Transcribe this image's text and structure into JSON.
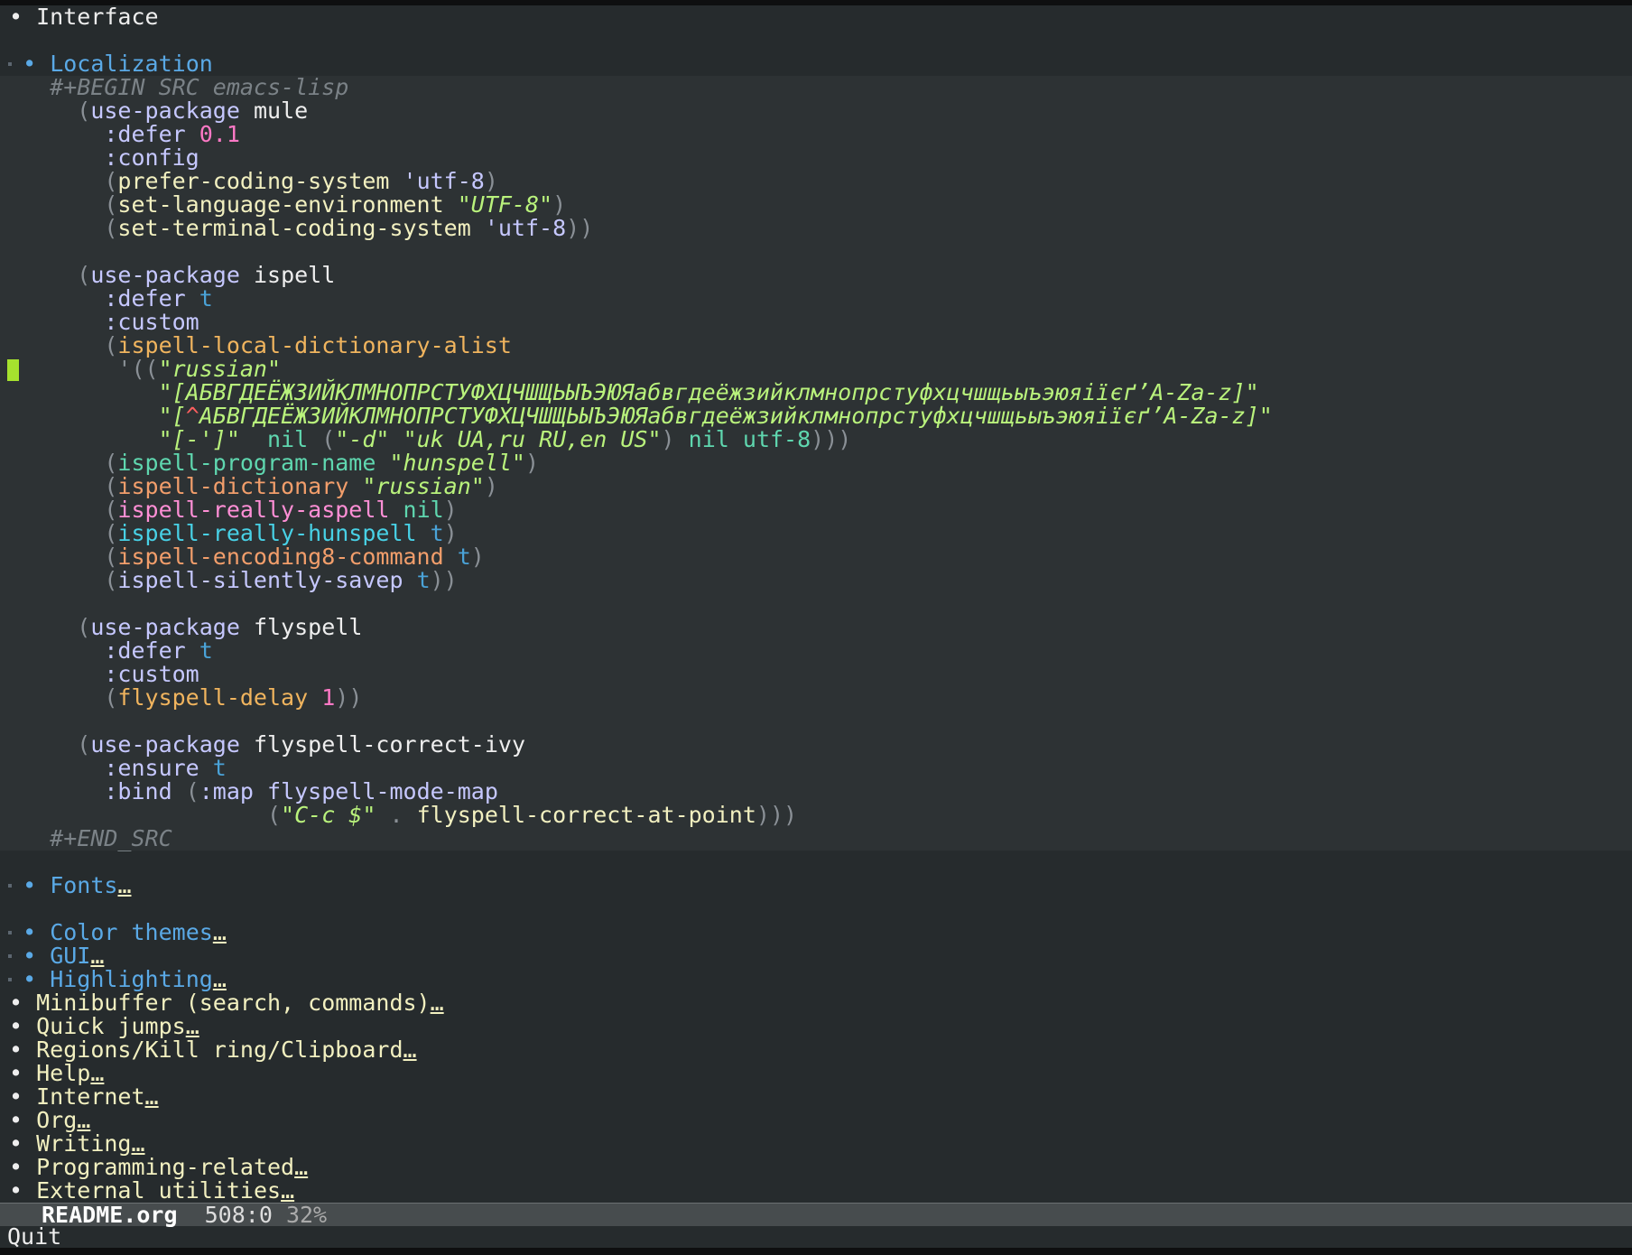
{
  "top_heading": "Interface",
  "bullet": "•",
  "section": "Localization",
  "src": {
    "begin": "#+BEGIN_SRC emacs-lisp",
    "end": "#+END_SRC",
    "l1_kw": "use-package",
    "l1_pkg": "mule",
    "defer": ":defer",
    "defer_val": "0.1",
    "config": ":config",
    "l4_fn": "prefer-coding-system",
    "l4_val": "'utf-8",
    "l5_fn": "set-language-environment",
    "l5_val": "\"UTF-8\"",
    "l6_fn": "set-terminal-coding-system",
    "l6_val": "'utf-8",
    "l8_pkg": "ispell",
    "t": "t",
    "custom": ":custom",
    "l11_fn": "ispell-local-dictionary-alist",
    "l12_a": "'((",
    "l12_b": "\"russian\"",
    "l13": "\"[АБВГДЕЁЖЗИЙКЛМНОПРСТУФХЦЧШЩЬЫЪЭЮЯабвгдеёжзийклмнопрстуфхцчшщьыъэюяіїєґ’A-Za-z]\"",
    "l14_a": "\"[",
    "l14_caret": "^",
    "l14_b": "АБВГДЕЁЖЗИЙКЛМНОПРСТУФХЦЧШЩЬЫЪЭЮЯабвгдеёжзийклмнопрстуфхцчшщьыъэюяіїєґ’A-Za-z]\"",
    "l15_a": "\"[-']\"",
    "l15_nil": "nil",
    "l15_b": "\"-d\"",
    "l15_c": "\"uk_UA,ru_RU,en_US\"",
    "l15_enc": "utf-8",
    "l16_fn": "ispell-program-name",
    "l16_val": "\"hunspell\"",
    "l17_fn": "ispell-dictionary",
    "l17_val": "\"russian\"",
    "l18_fn": "ispell-really-aspell",
    "l19_fn": "ispell-really-hunspell",
    "l20_fn": "ispell-encoding8-command",
    "l21_fn": "ispell-silently-savep",
    "l23_pkg": "flyspell",
    "l26_fn": "flyspell-delay",
    "l26_val": "1",
    "l28_pkg": "flyspell-correct-ivy",
    "ensure": ":ensure",
    "bind": ":bind",
    "map": ":map",
    "l30_map": "flyspell-mode-map",
    "l31_key": "\"C-c $\"",
    "l31_dot": ".",
    "l31_fn": "flyspell-correct-at-point"
  },
  "subsections": [
    {
      "label": "Fonts",
      "ellipsis": "…"
    },
    {
      "label": "Color themes",
      "ellipsis": "…"
    },
    {
      "label": "GUI",
      "ellipsis": "…"
    },
    {
      "label": "Highlighting",
      "ellipsis": "…"
    }
  ],
  "headings": [
    {
      "label": "Minibuffer (search, commands)",
      "ellipsis": "…"
    },
    {
      "label": "Quick jumps",
      "ellipsis": "…"
    },
    {
      "label": "Regions/Kill ring/Clipboard",
      "ellipsis": "…"
    },
    {
      "label": "Help",
      "ellipsis": "…"
    },
    {
      "label": "Internet",
      "ellipsis": "…"
    },
    {
      "label": "Org",
      "ellipsis": "…"
    },
    {
      "label": "Writing",
      "ellipsis": "…"
    },
    {
      "label": "Programming-related",
      "ellipsis": "…"
    },
    {
      "label": "External utilities",
      "ellipsis": "…"
    }
  ],
  "modeline": {
    "filename": "README.org",
    "position": "508:0",
    "percent": "32%"
  },
  "echo_area": "Quit"
}
